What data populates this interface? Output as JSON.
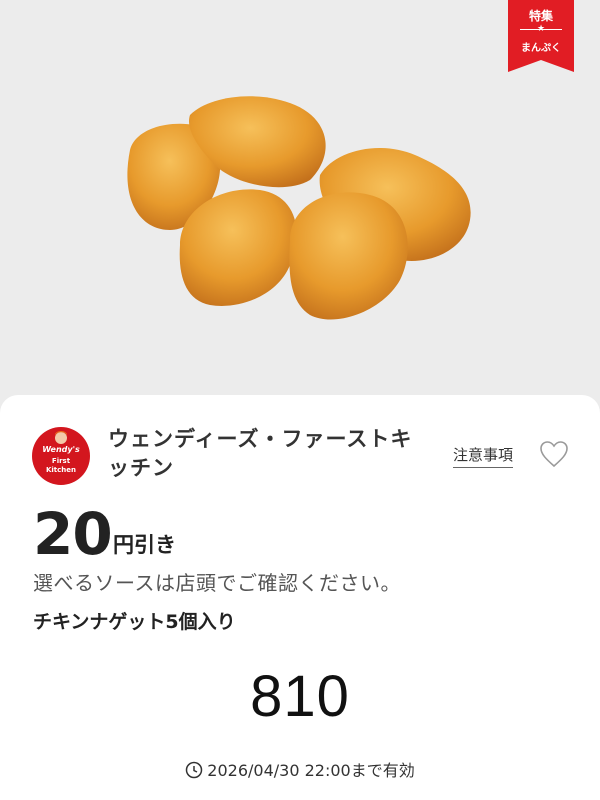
{
  "badge": {
    "top": "特集",
    "star": "★",
    "bottom": "まんぷく",
    "color": "#e11d24"
  },
  "logo": {
    "brand": "Wendy's",
    "line1": "First",
    "line2": "Kitchen",
    "color": "#d3161e"
  },
  "coupon": {
    "shop_name": "ウェンディーズ・ファーストキッチン",
    "notice_link": "注意事項",
    "discount_value": "20",
    "discount_unit": "円引き",
    "note": "選べるソースは店頭でご確認ください。",
    "item_name": "チキンナゲット5個入り",
    "code": "810",
    "expiry": "2026/04/30 22:00まで有効"
  },
  "icons": {
    "favorite": "heart-outline-icon",
    "expiry": "clock-icon"
  }
}
